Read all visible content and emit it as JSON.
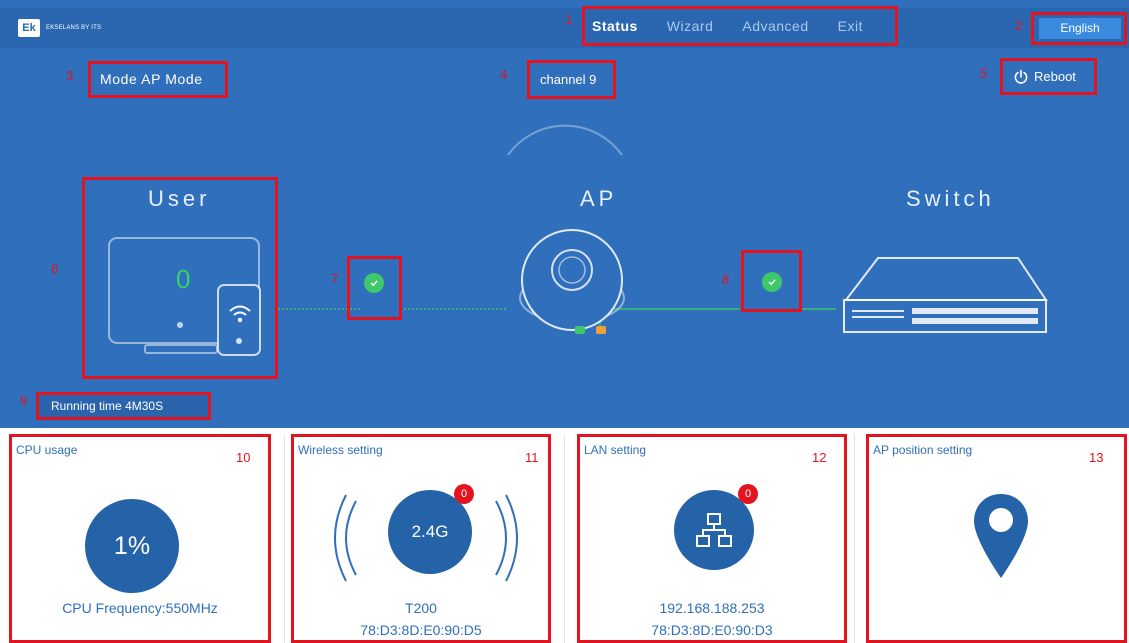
{
  "header": {
    "logo_mark": "Ek",
    "logo_text": "EKSELANS BY ITS",
    "nav": [
      "Status",
      "Wizard",
      "Advanced",
      "Exit"
    ],
    "active_nav": "Status",
    "language_button": "English"
  },
  "annotations": [
    "1",
    "2",
    "3",
    "4",
    "5",
    "6",
    "7",
    "8",
    "9",
    "10",
    "11",
    "12",
    "13"
  ],
  "status": {
    "mode_label": "Mode",
    "mode_value": "AP Mode",
    "channel_label": "channel",
    "channel_value": "9",
    "reboot_label": "Reboot"
  },
  "topology": {
    "user_title": "User",
    "ap_title": "AP",
    "switch_title": "Switch",
    "user_count": "0",
    "user_link": "connected",
    "switch_link": "connected"
  },
  "running": {
    "label": "Running time",
    "value": "4M30S"
  },
  "cards": {
    "cpu": {
      "title": "CPU usage",
      "value": "1%",
      "frequency": "CPU Frequency:550MHz"
    },
    "wireless": {
      "title": "Wireless setting",
      "band": "2.4G",
      "badge": "0",
      "ssid": "T200",
      "mac": "78:D3:8D:E0:90:D5"
    },
    "lan": {
      "title": "LAN setting",
      "badge": "0",
      "ip": "192.168.188.253",
      "mac": "78:D3:8D:E0:90:D3"
    },
    "position": {
      "title": "AP position setting"
    }
  },
  "colors": {
    "hero_blue": "#2f6fbb",
    "dark_blue": "#2563a9",
    "annotation_red": "#e3141f",
    "status_green": "#3fc86a"
  },
  "icons": {
    "logo": "ek-logo-icon",
    "reboot": "power-icon",
    "user_device": "monitor-phone-icon",
    "wifi": "wifi-icon",
    "ap": "access-point-icon",
    "switch": "network-switch-icon",
    "check": "check-icon",
    "lan": "network-tree-icon",
    "position": "map-pin-icon"
  }
}
